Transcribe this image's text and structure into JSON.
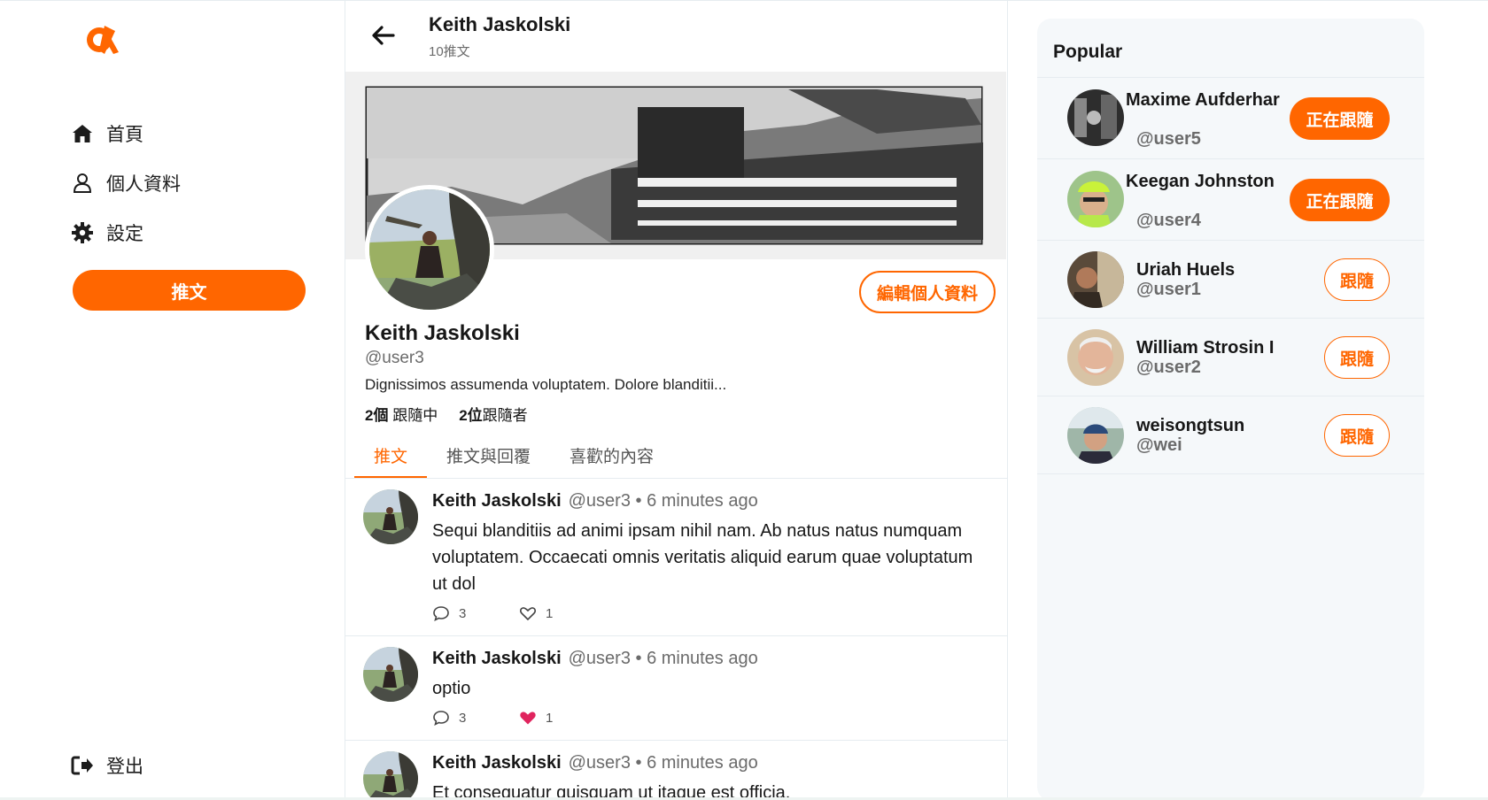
{
  "nav": {
    "items": [
      {
        "label": "首頁",
        "icon": "home-icon"
      },
      {
        "label": "個人資料",
        "icon": "user-icon"
      },
      {
        "label": "設定",
        "icon": "gear-icon"
      }
    ],
    "tweet_button": "推文",
    "logout": "登出"
  },
  "header": {
    "name": "Keith Jaskolski",
    "tweet_count": "10推文"
  },
  "profile": {
    "name": "Keith Jaskolski",
    "handle": "@user3",
    "bio": "Dignissimos assumenda voluptatem. Dolore blanditii...",
    "following_count": "2個",
    "following_label": "跟隨中",
    "followers_count": "2位",
    "followers_label": "跟隨者",
    "edit_button": "編輯個人資料"
  },
  "tabs": [
    "推文",
    "推文與回覆",
    "喜歡的內容"
  ],
  "tweets": [
    {
      "name": "Keith Jaskolski",
      "meta": "@user3 • 6 minutes ago",
      "text": "Sequi blanditiis ad animi ipsam nihil nam. Ab natus natus numquam voluptatem. Occaecati omnis veritatis aliquid earum quae voluptatum ut dol",
      "replies": "3",
      "likes": "1",
      "liked": false
    },
    {
      "name": "Keith Jaskolski",
      "meta": "@user3 • 6 minutes ago",
      "text": "optio",
      "replies": "3",
      "likes": "1",
      "liked": true
    },
    {
      "name": "Keith Jaskolski",
      "meta": "@user3 • 6 minutes ago",
      "text": "Et consequatur quisquam ut itaque est officia."
    }
  ],
  "popular": {
    "title": "Popular",
    "users": [
      {
        "name": "Maxime Aufderhar",
        "handle": "@user5",
        "button": "正在跟隨",
        "following": true
      },
      {
        "name": "Keegan Johnston",
        "handle": "@user4",
        "button": "正在跟隨",
        "following": true
      },
      {
        "name": "Uriah Huels",
        "handle": "@user1",
        "button": "跟隨",
        "following": false
      },
      {
        "name": "William Strosin I",
        "handle": "@user2",
        "button": "跟隨",
        "following": false
      },
      {
        "name": "weisongtsun",
        "handle": "@wei",
        "button": "跟隨",
        "following": false
      }
    ]
  },
  "colors": {
    "accent": "#ff6600",
    "like": "#e0245e",
    "muted": "#6b6b6b"
  }
}
